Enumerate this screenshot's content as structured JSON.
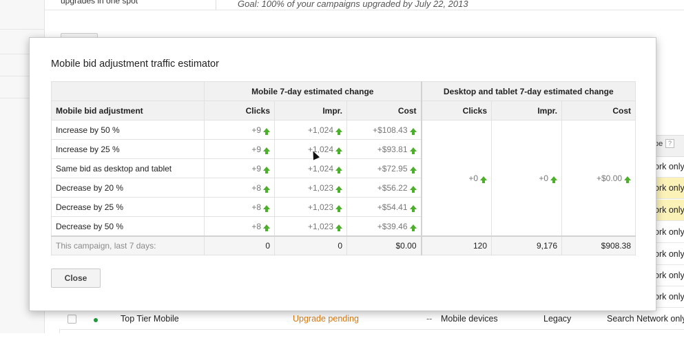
{
  "background": {
    "top_left_text": "upgrades in one spot",
    "goal_text": "Goal: 100% of your campaigns upgraded by July 22, 2013",
    "type_column_header": "pe",
    "help_icon_text": "?",
    "type_column_cells": [
      {
        "text": "ork only",
        "highlighted": false
      },
      {
        "text": "ork only",
        "highlighted": true
      },
      {
        "text": "ork only",
        "highlighted": true
      },
      {
        "text": "ork only",
        "highlighted": false
      },
      {
        "text": "ork only",
        "highlighted": false
      },
      {
        "text": "ork only",
        "highlighted": false
      },
      {
        "text": "ork only",
        "highlighted": false
      }
    ],
    "campaign_row": {
      "name": "Top Tier Mobile",
      "status": "Upgrade pending",
      "dash": "--",
      "devices": "Mobile devices",
      "type": "Legacy",
      "network": "Search Network only"
    },
    "colors": {
      "status_orange": "#d87b12",
      "highlight_yellow": "#fbf2b8",
      "enabled_dot": "#1e9b3a"
    }
  },
  "dialog": {
    "title": "Mobile bid adjustment traffic estimator",
    "group_headers": {
      "mobile": "Mobile 7-day estimated change",
      "desktop": "Desktop and tablet 7-day estimated change"
    },
    "columns": {
      "adjustment": "Mobile bid adjustment",
      "clicks": "Clicks",
      "impr": "Impr.",
      "cost": "Cost",
      "d_clicks": "Clicks",
      "d_impr": "Impr.",
      "d_cost": "Cost"
    },
    "rows": [
      {
        "label": "Increase by 50 %",
        "clicks": "+9",
        "impr": "+1,024",
        "cost": "+$108.43"
      },
      {
        "label": "Increase by 25 %",
        "clicks": "+9",
        "impr": "+1,024",
        "cost": "+$93.81"
      },
      {
        "label": "Same bid as desktop and tablet",
        "clicks": "+9",
        "impr": "+1,024",
        "cost": "+$72.95"
      },
      {
        "label": "Decrease by 20 %",
        "clicks": "+8",
        "impr": "+1,023",
        "cost": "+$56.22"
      },
      {
        "label": "Decrease by 25 %",
        "clicks": "+8",
        "impr": "+1,023",
        "cost": "+$54.41"
      },
      {
        "label": "Decrease by 50 %",
        "clicks": "+8",
        "impr": "+1,023",
        "cost": "+$39.46"
      }
    ],
    "desktop_change": {
      "clicks": "+0",
      "impr": "+0",
      "cost": "+$0.00"
    },
    "footer": {
      "label": "This campaign, last 7 days:",
      "clicks": "0",
      "impr": "0",
      "cost": "$0.00",
      "d_clicks": "120",
      "d_impr": "9,176",
      "d_cost": "$908.38"
    },
    "close_label": "Close",
    "arrow_icon": "green-up-arrow-icon",
    "arrow_color": "#4caf2a"
  }
}
